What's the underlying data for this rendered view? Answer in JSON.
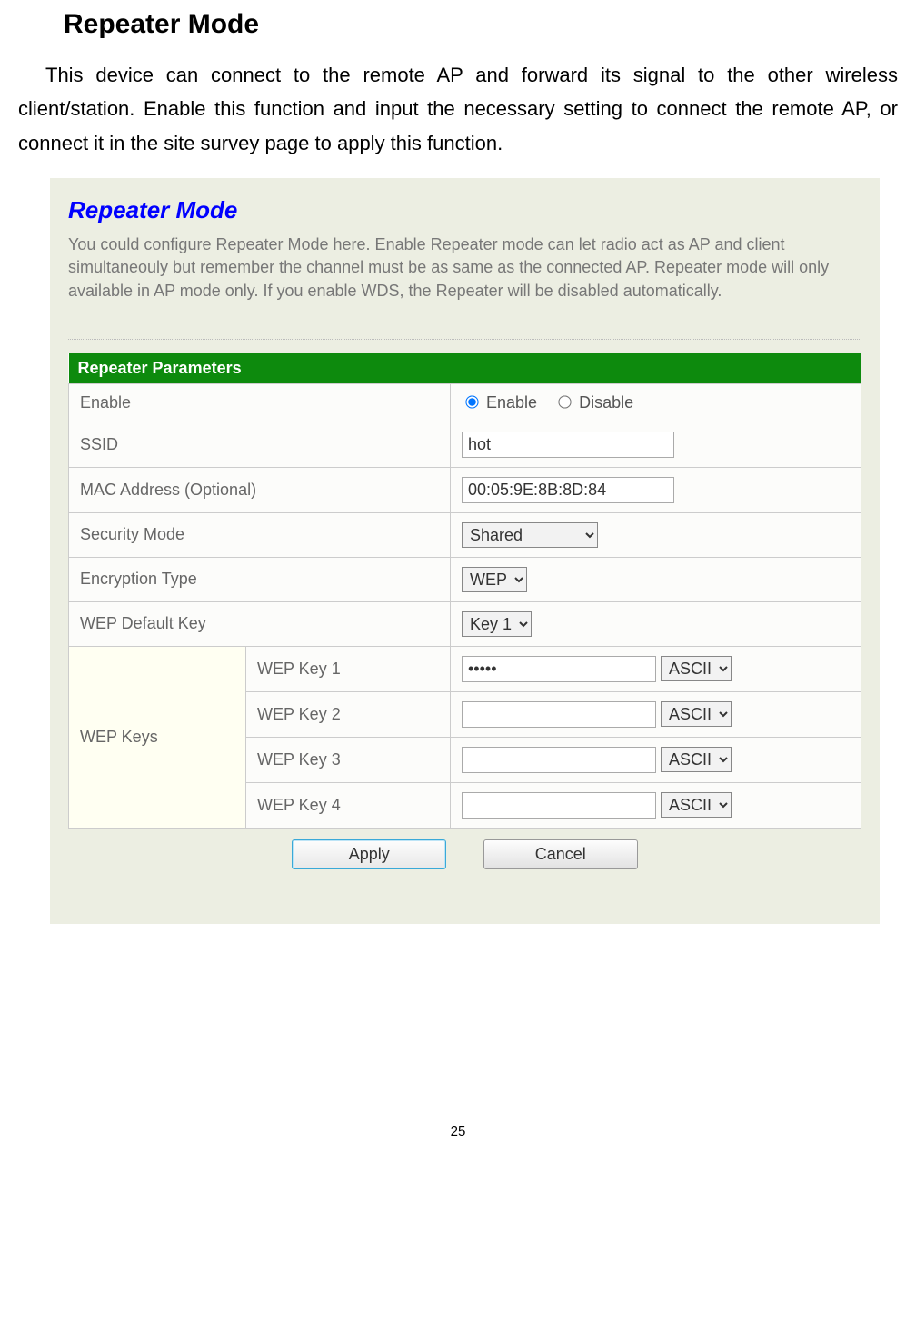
{
  "doc": {
    "title": "Repeater Mode",
    "paragraph": "This device can connect to the remote AP and forward its signal to the other wireless client/station. Enable this function and input the necessary setting to connect the remote AP, or connect it in the site survey page to apply this function.",
    "page_number": "25"
  },
  "panel": {
    "title": "Repeater Mode",
    "description": "You could configure Repeater Mode here. Enable Repeater mode can let radio act as AP and client simultaneouly but remember the channel must be as same as the connected AP. Repeater mode will only available in AP mode only. If you enable WDS, the Repeater will be disabled automatically.",
    "section_header": "Repeater Parameters",
    "rows": {
      "enable_label": "Enable",
      "enable_opt1": "Enable",
      "enable_opt2": "Disable",
      "ssid_label": "SSID",
      "ssid_value": "hot",
      "mac_label": "MAC Address (Optional)",
      "mac_value": "00:05:9E:8B:8D:84",
      "secmode_label": "Security Mode",
      "secmode_value": "Shared",
      "enctype_label": "Encryption Type",
      "enctype_value": "WEP",
      "defkey_label": "WEP Default Key",
      "defkey_value": "Key 1",
      "wepkeys_label": "WEP Keys",
      "wep1_label": "WEP Key 1",
      "wep1_value": "•••••",
      "wep2_label": "WEP Key 2",
      "wep2_value": "",
      "wep3_label": "WEP Key 3",
      "wep3_value": "",
      "wep4_label": "WEP Key 4",
      "wep4_value": "",
      "ascii_option": "ASCII"
    },
    "buttons": {
      "apply": "Apply",
      "cancel": "Cancel"
    }
  }
}
